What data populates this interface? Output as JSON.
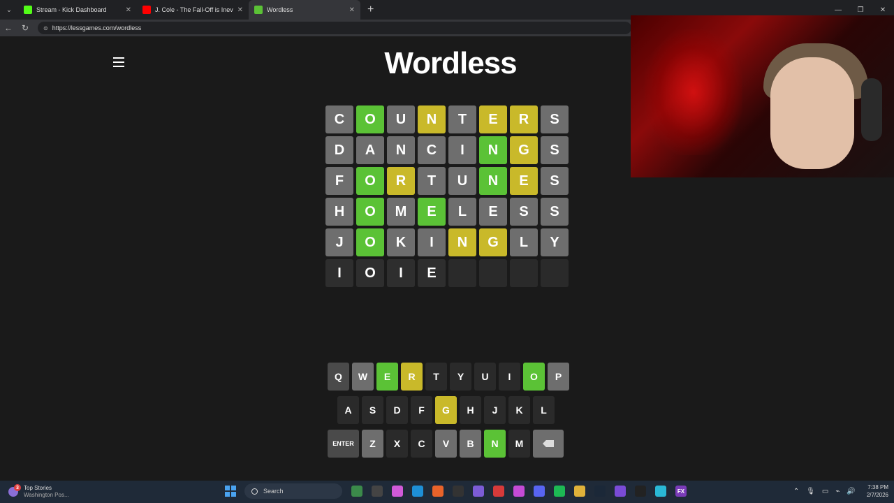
{
  "browser": {
    "tabs": [
      {
        "title": "Stream - Kick Dashboard",
        "icon": "kick-icon",
        "color": "#53fc18"
      },
      {
        "title": "J. Cole - The Fall-Off is Inevita",
        "icon": "youtube-icon",
        "color": "#ff0000"
      },
      {
        "title": "Wordless",
        "icon": "wordless-icon",
        "color": "#5bc236"
      }
    ],
    "url": "https://lessgames.com/wordless"
  },
  "game": {
    "title": "Wordless",
    "board": [
      [
        {
          "l": "C",
          "s": "gray"
        },
        {
          "l": "O",
          "s": "green"
        },
        {
          "l": "U",
          "s": "gray"
        },
        {
          "l": "N",
          "s": "yellow"
        },
        {
          "l": "T",
          "s": "gray"
        },
        {
          "l": "E",
          "s": "yellow"
        },
        {
          "l": "R",
          "s": "yellow"
        },
        {
          "l": "S",
          "s": "gray"
        }
      ],
      [
        {
          "l": "D",
          "s": "gray"
        },
        {
          "l": "A",
          "s": "gray"
        },
        {
          "l": "N",
          "s": "gray"
        },
        {
          "l": "C",
          "s": "gray"
        },
        {
          "l": "I",
          "s": "gray"
        },
        {
          "l": "N",
          "s": "green"
        },
        {
          "l": "G",
          "s": "yellow"
        },
        {
          "l": "S",
          "s": "gray"
        }
      ],
      [
        {
          "l": "F",
          "s": "gray"
        },
        {
          "l": "O",
          "s": "green"
        },
        {
          "l": "R",
          "s": "yellow"
        },
        {
          "l": "T",
          "s": "gray"
        },
        {
          "l": "U",
          "s": "gray"
        },
        {
          "l": "N",
          "s": "green"
        },
        {
          "l": "E",
          "s": "yellow"
        },
        {
          "l": "S",
          "s": "gray"
        }
      ],
      [
        {
          "l": "H",
          "s": "gray"
        },
        {
          "l": "O",
          "s": "green"
        },
        {
          "l": "M",
          "s": "gray"
        },
        {
          "l": "E",
          "s": "green"
        },
        {
          "l": "L",
          "s": "gray"
        },
        {
          "l": "E",
          "s": "gray"
        },
        {
          "l": "S",
          "s": "gray"
        },
        {
          "l": "S",
          "s": "gray"
        }
      ],
      [
        {
          "l": "J",
          "s": "gray"
        },
        {
          "l": "O",
          "s": "green"
        },
        {
          "l": "K",
          "s": "gray"
        },
        {
          "l": "I",
          "s": "gray"
        },
        {
          "l": "N",
          "s": "yellow"
        },
        {
          "l": "G",
          "s": "yellow"
        },
        {
          "l": "L",
          "s": "gray"
        },
        {
          "l": "Y",
          "s": "gray"
        }
      ],
      [
        {
          "l": "I",
          "s": "dark"
        },
        {
          "l": "O",
          "s": "dark"
        },
        {
          "l": "I",
          "s": "dark"
        },
        {
          "l": "E",
          "s": "dark"
        },
        {
          "l": "",
          "s": "empty"
        },
        {
          "l": "",
          "s": "empty"
        },
        {
          "l": "",
          "s": "empty"
        },
        {
          "l": "",
          "s": "empty"
        }
      ]
    ],
    "keyboard": [
      [
        {
          "k": "Q",
          "s": "default"
        },
        {
          "k": "W",
          "s": "gray"
        },
        {
          "k": "E",
          "s": "green"
        },
        {
          "k": "R",
          "s": "yellow"
        },
        {
          "k": "T",
          "s": "dark"
        },
        {
          "k": "Y",
          "s": "dark"
        },
        {
          "k": "U",
          "s": "dark"
        },
        {
          "k": "I",
          "s": "dark"
        },
        {
          "k": "O",
          "s": "green"
        },
        {
          "k": "P",
          "s": "gray"
        }
      ],
      [
        {
          "k": "A",
          "s": "dark"
        },
        {
          "k": "S",
          "s": "dark"
        },
        {
          "k": "D",
          "s": "dark"
        },
        {
          "k": "F",
          "s": "dark"
        },
        {
          "k": "G",
          "s": "yellow"
        },
        {
          "k": "H",
          "s": "dark"
        },
        {
          "k": "J",
          "s": "dark"
        },
        {
          "k": "K",
          "s": "dark"
        },
        {
          "k": "L",
          "s": "dark"
        }
      ],
      [
        {
          "k": "ENTER",
          "s": "default",
          "wide": true
        },
        {
          "k": "Z",
          "s": "gray"
        },
        {
          "k": "X",
          "s": "dark"
        },
        {
          "k": "C",
          "s": "dark"
        },
        {
          "k": "V",
          "s": "gray"
        },
        {
          "k": "B",
          "s": "gray"
        },
        {
          "k": "N",
          "s": "green"
        },
        {
          "k": "M",
          "s": "dark"
        },
        {
          "k": "",
          "s": "back"
        }
      ]
    ]
  },
  "taskbar": {
    "news_title": "Top Stories",
    "news_sub": "Washington Pos...",
    "news_badge": "3",
    "search_placeholder": "Search",
    "time": "7:38 PM",
    "date": "2/7/2026"
  }
}
